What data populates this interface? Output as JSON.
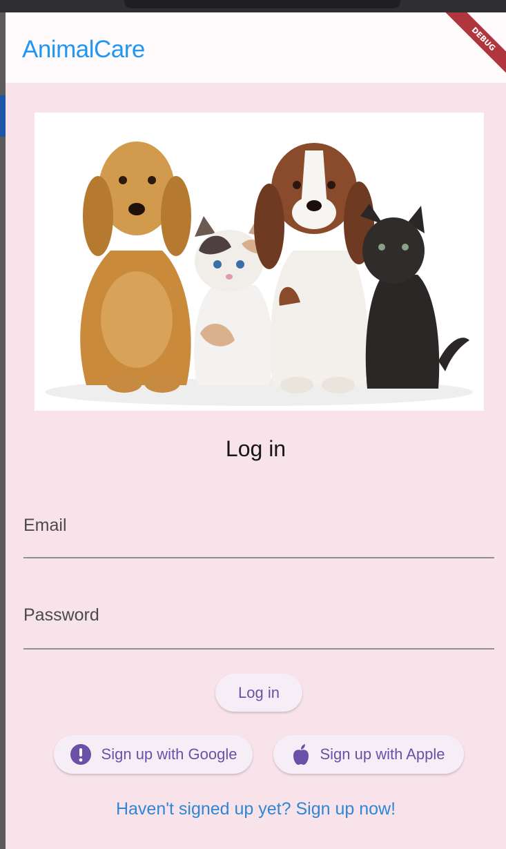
{
  "app": {
    "title": "AnimalCare",
    "debug_banner": "DEBUG"
  },
  "login": {
    "heading": "Log in",
    "submit_label": "Log in"
  },
  "form": {
    "email": {
      "label": "Email",
      "value": ""
    },
    "password": {
      "label": "Password",
      "value": ""
    }
  },
  "social": {
    "google_label": "Sign up with Google",
    "apple_label": "Sign up with Apple"
  },
  "footer": {
    "signup_prompt": "Haven't signed up yet? Sign up now!"
  },
  "colors": {
    "accent": "#2196f3",
    "button_text": "#6a50a6",
    "background": "#f9e3ea"
  },
  "icons": [
    "alert-circle-icon",
    "apple-icon"
  ]
}
